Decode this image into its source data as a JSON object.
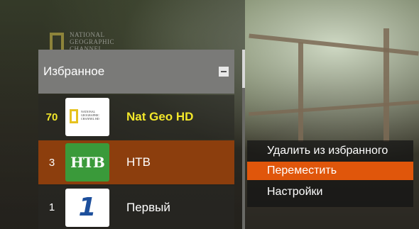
{
  "watermark": {
    "brand_lines": [
      "NATIONAL",
      "GEOGRAPHIC",
      "CHANNEL"
    ]
  },
  "favorites_panel": {
    "title": "Избранное",
    "collapse_icon": "minus-box-icon",
    "channels": [
      {
        "number": "70",
        "name": "Nat Geo HD",
        "logo": "natgeo-logo-icon",
        "logo_text": [
          "NATIONAL",
          "GEOGRAPHIC",
          "CHANNEL HD"
        ],
        "selected": false,
        "focused_color": "#f2e72a"
      },
      {
        "number": "3",
        "name": "НТВ",
        "logo": "ntv-logo-icon",
        "logo_text": "НТВ",
        "selected": true
      },
      {
        "number": "1",
        "name": "Первый",
        "logo": "first-channel-logo-icon",
        "logo_text": "1",
        "selected": false
      }
    ]
  },
  "context_menu": {
    "items": [
      {
        "label": "Удалить из избранного",
        "highlighted": false
      },
      {
        "label": "Переместить",
        "highlighted": true
      },
      {
        "label": "Настройки",
        "highlighted": false
      }
    ]
  },
  "colors": {
    "header_bg": "#7a7a78",
    "selected_row": "#8c3e0d",
    "menu_highlight": "#e0560b",
    "favorite_text": "#f2e72a"
  }
}
